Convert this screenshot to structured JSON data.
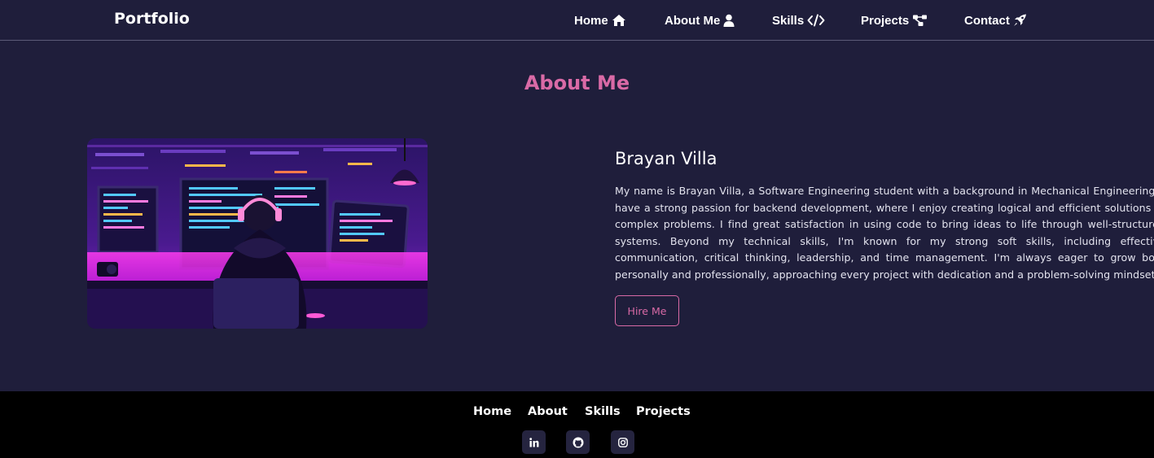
{
  "navbar": {
    "brand": "Portfolio",
    "items": [
      {
        "label": "Home",
        "icon": "home-icon"
      },
      {
        "label": "About Me",
        "icon": "user-icon"
      },
      {
        "label": "Skills",
        "icon": "code-icon"
      },
      {
        "label": "Projects",
        "icon": "diagram-project-icon"
      },
      {
        "label": "Contact",
        "icon": "rocket-icon"
      }
    ]
  },
  "about": {
    "title": "About Me",
    "image_subject": "hooded developer with headphones at a multi-monitor desk in a purple neon room",
    "name": "Brayan Villa",
    "bio": "My name is Brayan Villa, a Software Engineering student with a background in Mechanical Engineering. I have a strong passion for backend development, where I enjoy creating logical and efficient solutions to complex problems. I find great satisfaction in using code to bring ideas to life through well-structured systems. Beyond my technical skills, I'm known for my strong soft skills, including effective communication, critical thinking, leadership, and time management. I'm always eager to grow both personally and professionally, approaching every project with dedication and a problem-solving mindset.",
    "hire_label": "Hire Me"
  },
  "footer": {
    "links": [
      "Home",
      "About",
      "Skills",
      "Projects"
    ],
    "social": [
      "linkedin-icon",
      "github-icon",
      "instagram-icon"
    ]
  },
  "colors": {
    "background": "#1f1e3b",
    "accent": "#d96aa6",
    "footer": "#000000"
  }
}
